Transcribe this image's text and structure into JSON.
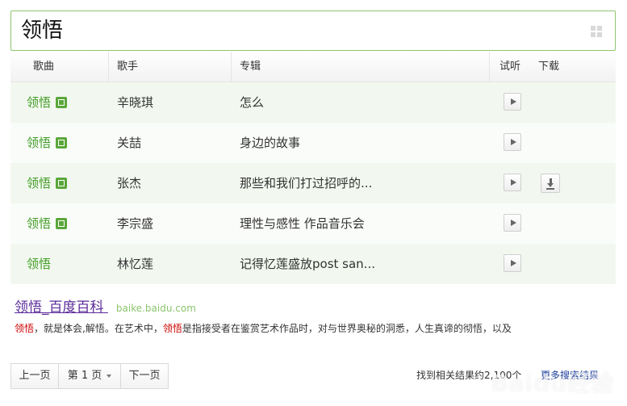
{
  "search": {
    "query": "领悟"
  },
  "table": {
    "headers": {
      "song": "歌曲",
      "singer": "歌手",
      "album": "专辑",
      "preview": "试听",
      "download": "下载"
    },
    "rows": [
      {
        "song": "领悟",
        "singer": "辛晓琪",
        "album": "怎么",
        "has_mv": true,
        "has_download": false
      },
      {
        "song": "领悟",
        "singer": "关喆",
        "album": "身边的故事",
        "has_mv": true,
        "has_download": false
      },
      {
        "song": "领悟",
        "singer": "张杰",
        "album": "那些和我们打过招呼的...",
        "has_mv": true,
        "has_download": true
      },
      {
        "song": "领悟",
        "singer": "李宗盛",
        "album": "理性与感性 作品音乐会",
        "has_mv": true,
        "has_download": false
      },
      {
        "song": "领悟",
        "singer": "林忆莲",
        "album": "记得忆莲盛放post san...",
        "has_mv": false,
        "has_download": false
      }
    ]
  },
  "baike": {
    "title_keyword": "领悟",
    "title_suffix": "_百度百科",
    "domain": "baike.baidu.com",
    "snippet_keyword_1": "领悟",
    "snippet_text_1": "，就是体会,解悟。在艺术中，",
    "snippet_keyword_2": "领悟",
    "snippet_text_2": "是指接受者在鉴赏艺术作品时，对与世界奥秘的洞悉，人生真谛的彻悟，以及"
  },
  "pager": {
    "prev_label": "上一页",
    "current_label": "第 1 页",
    "next_label": "下一页"
  },
  "footer": {
    "summary_text": "找到相关结果约2,100个",
    "more_results_label": "更多搜索结果"
  },
  "watermark": {
    "text": "Baidu经验"
  },
  "colors": {
    "accent_green": "#3f9b23",
    "search_border": "#8fc56d",
    "row_alt": "#f2f8ef",
    "link_purple": "#5a2b9a",
    "link_blue": "#1d3e9c"
  }
}
